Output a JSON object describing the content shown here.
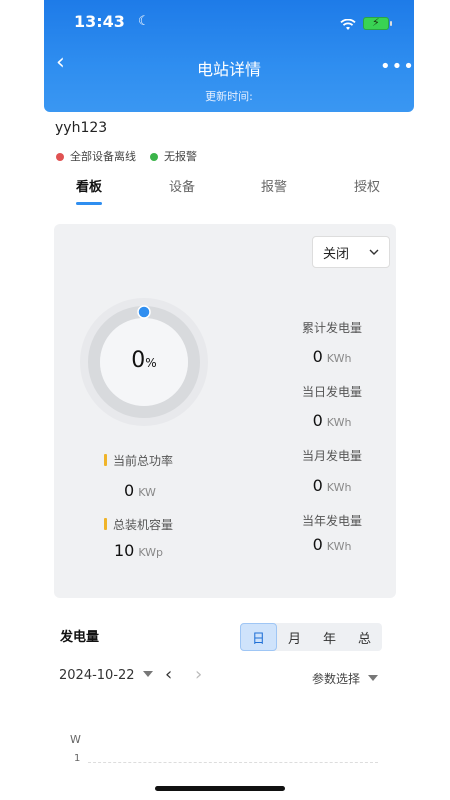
{
  "status_bar": {
    "time": "13:43"
  },
  "header": {
    "title": "电站详情",
    "update_label": "更新时间:"
  },
  "station": {
    "name": "yyh123",
    "device_status": "全部设备离线",
    "alarm_status": "无报警"
  },
  "tabs": [
    {
      "label": "看板"
    },
    {
      "label": "设备"
    },
    {
      "label": "报警"
    },
    {
      "label": "授权"
    }
  ],
  "dashboard": {
    "mode_select": "关闭",
    "gauge": {
      "value": "0",
      "unit": "%",
      "fraction": 0
    },
    "left_metrics": [
      {
        "label": "当前总功率",
        "value": "0",
        "unit": "KW"
      },
      {
        "label": "总装机容量",
        "value": "10",
        "unit": "KWp"
      }
    ],
    "right_metrics": [
      {
        "label": "累计发电量",
        "value": "0",
        "unit": "KWh"
      },
      {
        "label": "当日发电量",
        "value": "0",
        "unit": "KWh"
      },
      {
        "label": "当月发电量",
        "value": "0",
        "unit": "KWh"
      },
      {
        "label": "当年发电量",
        "value": "0",
        "unit": "KWh"
      }
    ]
  },
  "generation": {
    "title": "发电量",
    "periods": [
      "日",
      "月",
      "年",
      "总"
    ],
    "active_period": "日",
    "date": "2024-10-22",
    "param_select": "参数选择",
    "chart": {
      "y_unit": "W",
      "y_tick": "1"
    }
  },
  "colors": {
    "header_blue": "#2f8ef0",
    "offline_dot": "#e05252",
    "ok_dot": "#3bb44a",
    "accent_bar": "#f0b429"
  }
}
